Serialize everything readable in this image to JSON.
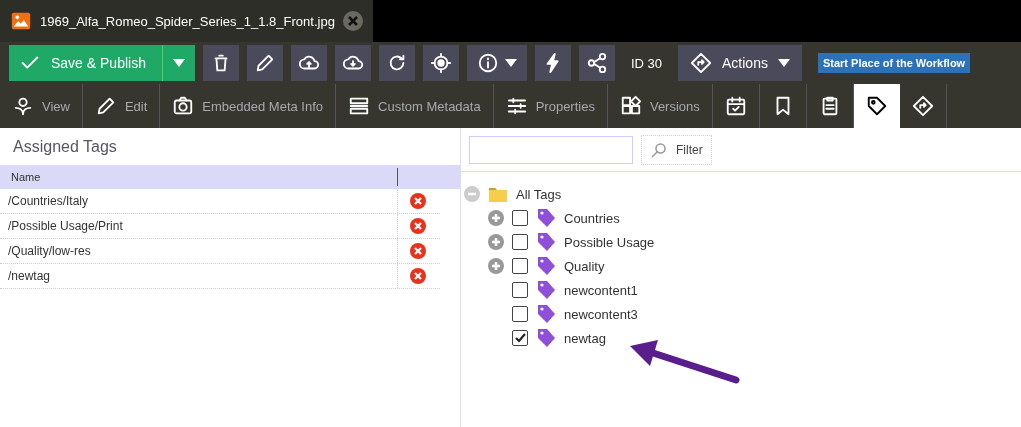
{
  "document_tab": {
    "title": "1969_Alfa_Romeo_Spider_Series_1_1.8_Front.jpg"
  },
  "toolbar": {
    "save_button": "Save & Publish",
    "id_label": "ID 30",
    "actions_button": "Actions",
    "workflow_badge": "Start Place of the Workflow"
  },
  "nav_tabs": [
    {
      "label": "View",
      "selected": false
    },
    {
      "label": "Edit",
      "selected": false
    },
    {
      "label": "Embedded Meta Info",
      "selected": false
    },
    {
      "label": "Custom Metadata",
      "selected": false
    },
    {
      "label": "Properties",
      "selected": false
    },
    {
      "label": "Versions",
      "selected": false
    },
    {
      "selected": false
    },
    {
      "selected": false
    },
    {
      "selected": false
    },
    {
      "selected": true
    },
    {
      "selected": false
    }
  ],
  "assigned_tags": {
    "title": "Assigned Tags",
    "columns": [
      "Name"
    ],
    "rows": [
      "/Countries/Italy",
      "/Possible Usage/Print",
      "/Quality/low-res",
      "/newtag"
    ]
  },
  "tag_tree": {
    "filter_button": "Filter",
    "root": {
      "label": "All Tags",
      "expanded": true,
      "children": [
        {
          "label": "Countries",
          "has_children": true,
          "checked": false
        },
        {
          "label": "Possible Usage",
          "has_children": true,
          "checked": false
        },
        {
          "label": "Quality",
          "has_children": true,
          "checked": false
        },
        {
          "label": "newcontent1",
          "has_children": false,
          "checked": false
        },
        {
          "label": "newcontent3",
          "has_children": false,
          "checked": false
        },
        {
          "label": "newtag",
          "has_children": false,
          "checked": true
        }
      ]
    }
  }
}
